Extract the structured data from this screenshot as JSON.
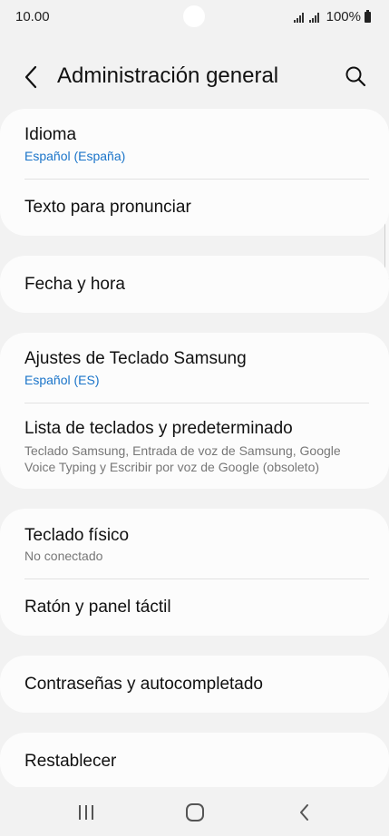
{
  "status_bar": {
    "time": "10.00",
    "battery": "100%",
    "icons": [
      "signal-icon",
      "signal-icon",
      "battery-icon"
    ]
  },
  "header": {
    "title": "Administración general",
    "back_icon": "chevron-left-icon",
    "search_icon": "search-icon"
  },
  "groups": [
    {
      "items": [
        {
          "title": "Idioma",
          "subtitle": "Español (España)"
        },
        {
          "title": "Texto para pronunciar"
        }
      ]
    },
    {
      "items": [
        {
          "title": "Fecha y hora"
        }
      ]
    },
    {
      "items": [
        {
          "title": "Ajustes de Teclado Samsung",
          "subtitle": "Español (ES)"
        },
        {
          "title": "Lista de teclados y predeterminado",
          "subtitle": "Teclado Samsung, Entrada de voz de Samsung, Google Voice Typing y Escribir por voz de Google (obsoleto)"
        }
      ]
    },
    {
      "items": [
        {
          "title": "Teclado físico",
          "subtitle": "No conectado"
        },
        {
          "title": "Ratón y panel táctil"
        }
      ]
    },
    {
      "items": [
        {
          "title": "Contraseñas y autocompletado"
        }
      ]
    },
    {
      "items": [
        {
          "title": "Restablecer"
        }
      ]
    }
  ],
  "nav_bar": {
    "icons": [
      "recent-apps-icon",
      "home-icon",
      "back-icon"
    ]
  },
  "colors": {
    "background": "#f2f2f2",
    "card": "#fcfcfc",
    "accent_subtitle": "#1a74c9",
    "secondary_text": "#777777"
  }
}
